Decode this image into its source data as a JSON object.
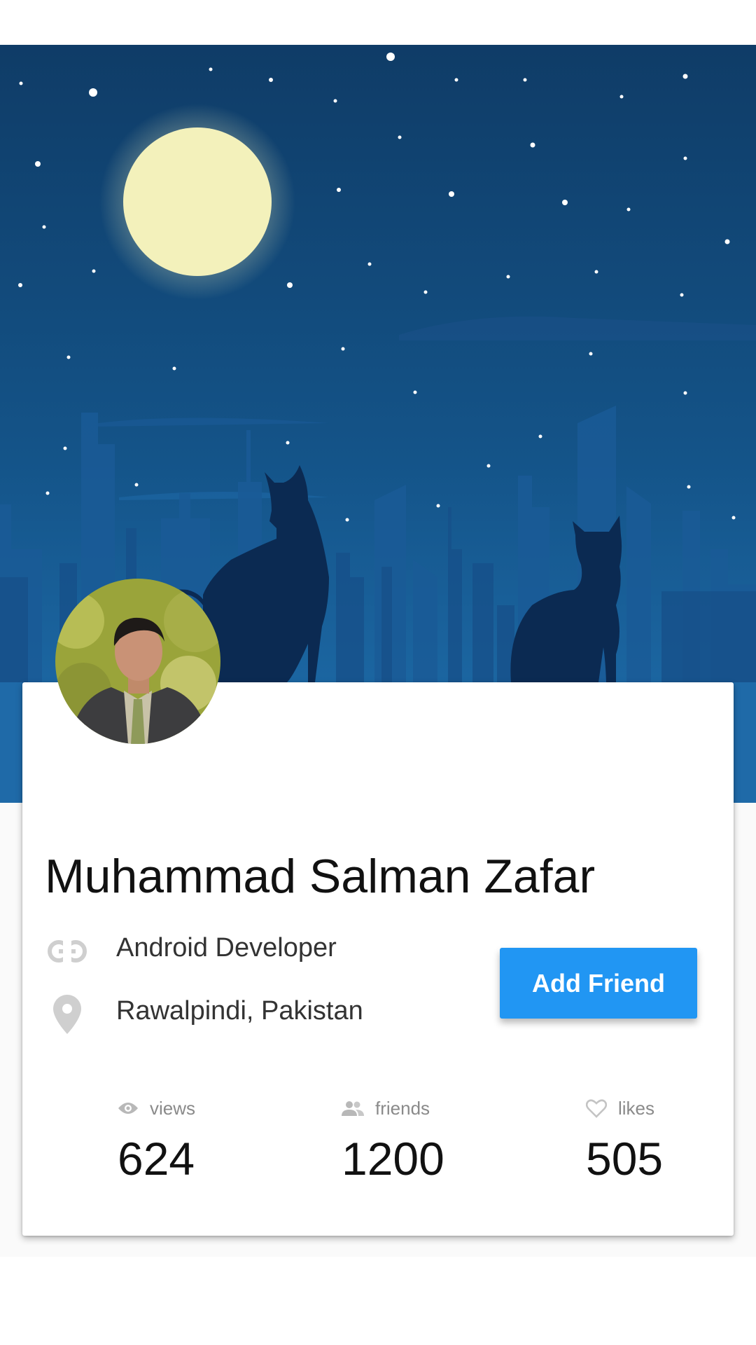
{
  "profile": {
    "name": "Muhammad Salman Zafar",
    "title": "Android Developer",
    "location": "Rawalpindi, Pakistan"
  },
  "actions": {
    "add_friend_label": "Add Friend"
  },
  "stats": [
    {
      "label": "views",
      "value": "624",
      "icon": "eye-icon"
    },
    {
      "label": "friends",
      "value": "1200",
      "icon": "people-icon"
    },
    {
      "label": "likes",
      "value": "505",
      "icon": "heart-icon"
    }
  ],
  "icons": {
    "title": "link-icon",
    "location": "location-pin-icon"
  },
  "colors": {
    "accent": "#2196f3",
    "header_sky_top": "#103d68",
    "header_sky_bottom": "#1b6aa8",
    "moon": "#f3f1bb",
    "silhouette": "#0b2a52"
  }
}
